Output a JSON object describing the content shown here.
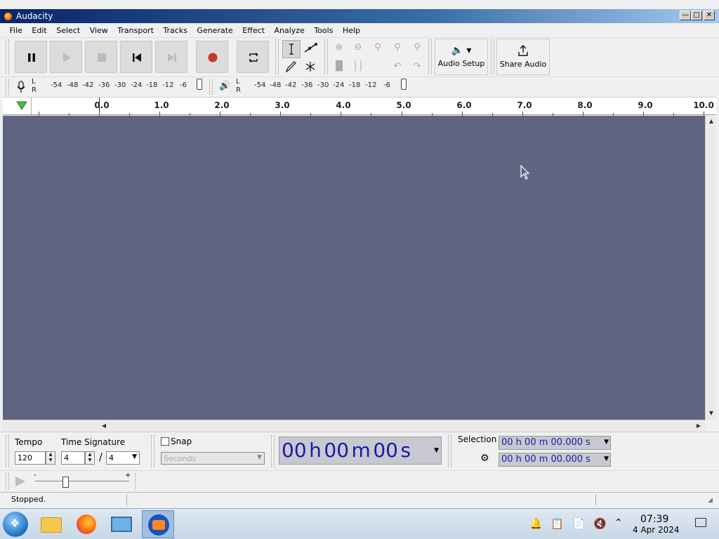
{
  "window": {
    "title": "Audacity"
  },
  "menu": [
    "File",
    "Edit",
    "Select",
    "View",
    "Transport",
    "Tracks",
    "Generate",
    "Effect",
    "Analyze",
    "Tools",
    "Help"
  ],
  "toolbar": {
    "audio_setup_label": "Audio Setup",
    "share_audio_label": "Share Audio"
  },
  "meters": {
    "rec_scale": [
      "-54",
      "-48",
      "-42",
      "-36",
      "-30",
      "-24",
      "-18",
      "-12",
      "-6"
    ],
    "play_scale": [
      "-54",
      "-48",
      "-42",
      "-36",
      "-30",
      "-24",
      "-18",
      "-12",
      "-6"
    ],
    "channel_l": "L",
    "channel_r": "R"
  },
  "ruler": {
    "labels": [
      "0.0",
      "1.0",
      "2.0",
      "3.0",
      "4.0",
      "5.0",
      "6.0",
      "7.0",
      "8.0",
      "9.0",
      "10.0"
    ]
  },
  "bottom": {
    "tempo_label": "Tempo",
    "tempo_value": "120",
    "time_signature_label": "Time Signature",
    "ts_numerator": "4",
    "ts_divider": "/",
    "ts_denominator": "4",
    "snap_label": "Snap",
    "snap_unit": "Seconds",
    "time_display": {
      "h": "00",
      "h_unit": "h",
      "m": "00",
      "m_unit": "m",
      "s": "00",
      "s_unit": "s"
    },
    "selection_label": "Selection",
    "selection_start": "00 h 00 m 00.000 s",
    "selection_end": "00 h 00 m 00.000 s"
  },
  "play_speed": {
    "minus": "-",
    "plus": "+"
  },
  "status": {
    "text": "Stopped."
  },
  "taskbar": {
    "time": "07:39",
    "date": "4 Apr 2024"
  },
  "colors": {
    "track_bg": "#5f6480",
    "record_red": "#c0392b",
    "time_digits": "#1a1aa8"
  }
}
